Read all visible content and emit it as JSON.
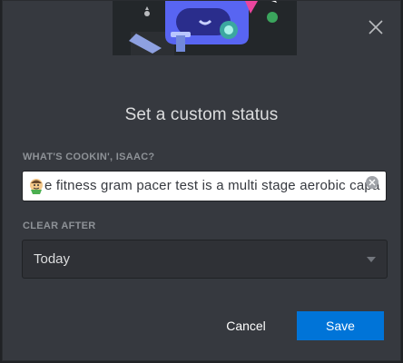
{
  "modal": {
    "title": "Set a custom status",
    "close_icon": "close-icon",
    "illustration_icon": "robot-mascot-illustration"
  },
  "status": {
    "label": "WHAT'S COOKIN', ISAAC?",
    "emoji_icon": "emoji-face-icon",
    "value": "e fitness gram pacer test is a multi stage aerobic capac",
    "clear_icon": "clear-x-icon"
  },
  "clear_after": {
    "label": "CLEAR AFTER",
    "selected": "Today",
    "chevron_icon": "chevron-down-icon"
  },
  "footer": {
    "cancel_label": "Cancel",
    "save_label": "Save"
  },
  "colors": {
    "background": "#36393f",
    "input_bg": "#ffffff",
    "select_bg": "#2f3136",
    "accent": "#0074d8",
    "muted_text": "#8e9297"
  }
}
